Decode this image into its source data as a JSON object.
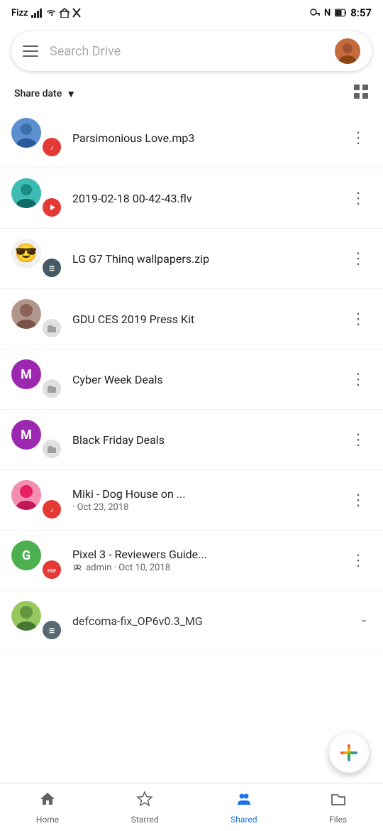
{
  "statusBar": {
    "carrier": "Fizz",
    "time": "8:57",
    "batteryLevel": "67"
  },
  "searchBar": {
    "placeholder": "Search Drive",
    "hamburgerLabel": "Menu"
  },
  "sortRow": {
    "label": "Share date",
    "arrowDirection": "down",
    "viewToggleLabel": "Grid view"
  },
  "files": [
    {
      "id": 1,
      "name": "Parsimonious Love.mp3",
      "date": "",
      "fileType": "audio",
      "fileTypeLabel": "♪",
      "sharerAvatarType": "blue-person",
      "sharerInitial": ""
    },
    {
      "id": 2,
      "name": "2019-02-18 00-42-43.flv",
      "date": "",
      "fileType": "video",
      "fileTypeLabel": "▶",
      "sharerAvatarType": "teal-person",
      "sharerInitial": ""
    },
    {
      "id": 3,
      "name": "LG G7 Thinq wallpapers.zip",
      "date": "",
      "fileType": "zip",
      "fileTypeLabel": "☰",
      "sharerAvatarType": "emoji",
      "sharerInitial": "😎"
    },
    {
      "id": 4,
      "name": "GDU CES 2019 Press Kit",
      "date": "",
      "fileType": "folder",
      "fileTypeLabel": "▢",
      "sharerAvatarType": "person-photo",
      "sharerInitial": ""
    },
    {
      "id": 5,
      "name": "Cyber Week Deals",
      "date": "",
      "fileType": "folder",
      "fileTypeLabel": "▢",
      "sharerAvatarType": "purple-M",
      "sharerInitial": "M"
    },
    {
      "id": 6,
      "name": "Black Friday Deals",
      "date": "",
      "fileType": "folder",
      "fileTypeLabel": "▢",
      "sharerAvatarType": "purple-M",
      "sharerInitial": "M"
    },
    {
      "id": 7,
      "name": "Miki - Dog House on ...",
      "date": "· Oct 23, 2018",
      "fileType": "audio",
      "fileTypeLabel": "♪",
      "sharerAvatarType": "pink-person",
      "sharerInitial": ""
    },
    {
      "id": 8,
      "name": "Pixel 3 - Reviewers Guide...",
      "date": "admin · Oct 10, 2018",
      "fileType": "pdf",
      "fileTypeLabel": "PDF",
      "sharerAvatarType": "green-G",
      "sharerInitial": "G"
    },
    {
      "id": 9,
      "name": "defcoma-fix_OP6v0.3_MG",
      "date": "",
      "fileType": "zip",
      "fileTypeLabel": "☰",
      "sharerAvatarType": "mixed",
      "sharerInitial": ""
    }
  ],
  "bottomNav": {
    "items": [
      {
        "id": "home",
        "label": "Home",
        "icon": "⌂",
        "active": false
      },
      {
        "id": "starred",
        "label": "Starred",
        "icon": "☆",
        "active": false
      },
      {
        "id": "shared",
        "label": "Shared",
        "icon": "👥",
        "active": true
      },
      {
        "id": "files",
        "label": "Files",
        "icon": "▢",
        "active": false
      }
    ]
  },
  "fab": {
    "label": "Add"
  }
}
